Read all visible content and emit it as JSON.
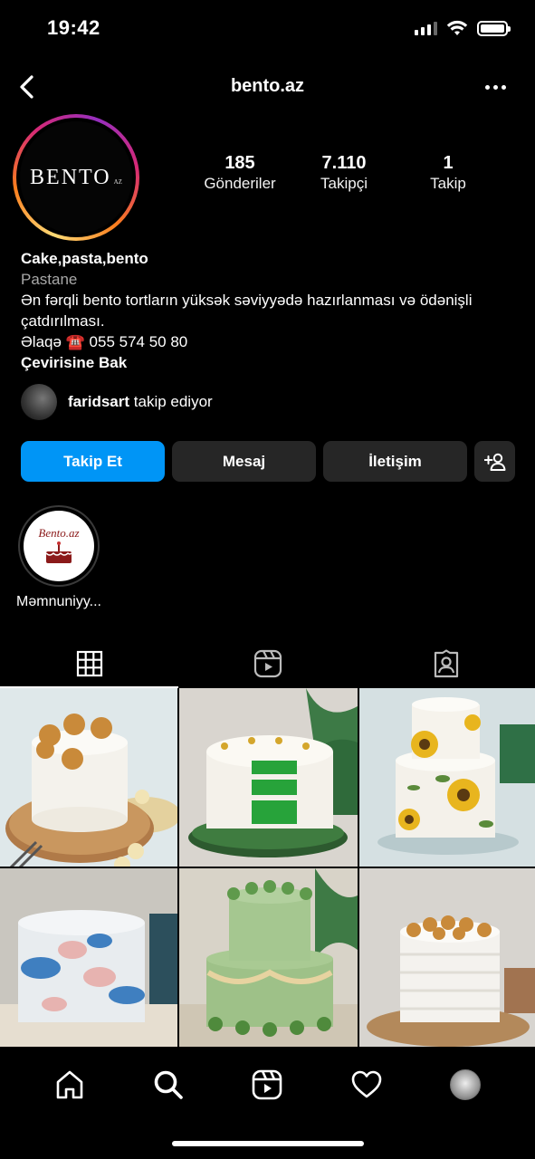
{
  "status_bar": {
    "time": "19:42"
  },
  "header": {
    "username": "bento.az"
  },
  "profile": {
    "avatar_logo": "BENTO",
    "avatar_logo_sub": "AZ",
    "stats": [
      {
        "value": "185",
        "label": "Gönderiler"
      },
      {
        "value": "7.110",
        "label": "Takipçi"
      },
      {
        "value": "1",
        "label": "Takip"
      }
    ],
    "name": "Cake,pasta,bento",
    "category": "Pastane",
    "bio_line1": "Ən fərqli bento tortların yüksək səviyyədə hazırlanması və ödənişli çatdırılması.",
    "bio_line2": "Əlaqə ☎️ 055 574 50 80",
    "translate": "Çevirisine Bak",
    "followed_by_user": "faridsart",
    "followed_by_text": "takip ediyor"
  },
  "actions": {
    "follow": "Takip Et",
    "message": "Mesaj",
    "contact": "İletişim"
  },
  "highlights": [
    {
      "label": "Məmnuniyy...",
      "logo_text": "Bento.az"
    }
  ],
  "colors": {
    "accent": "#0095f6",
    "button_bg": "#262626",
    "secondary_text": "#a8a8a8"
  },
  "icons": {
    "tabs": [
      "grid-icon",
      "reels-icon",
      "tagged-icon"
    ],
    "nav": [
      "home-icon",
      "search-icon",
      "reels-icon",
      "heart-icon",
      "profile-avatar"
    ]
  }
}
